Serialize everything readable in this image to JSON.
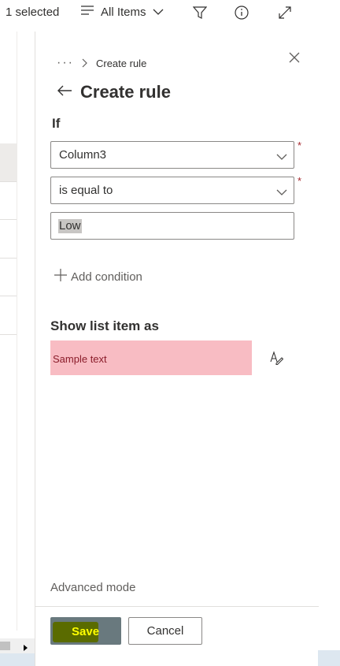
{
  "topbar": {
    "selected_text": "1 selected",
    "view_label": "All Items"
  },
  "panel": {
    "breadcrumb_current": "Create rule",
    "title": "Create rule",
    "if_label": "If",
    "condition": {
      "column_value": "Column3",
      "operator_value": "is equal to",
      "value": "Low",
      "required_marker": "*"
    },
    "add_condition_label": "Add condition",
    "show_label": "Show list item as",
    "sample_text": "Sample text",
    "sample_colors": {
      "background": "#f8bcc3",
      "text": "#8a1c2a"
    },
    "advanced_mode_label": "Advanced mode"
  },
  "footer": {
    "save_label": "Save",
    "cancel_label": "Cancel"
  },
  "colors": {
    "save_button": "#69797e",
    "save_highlight": "#5a6b00",
    "save_text": "#ffff00",
    "required": "#a4262c"
  },
  "icons": {
    "view": "list-lines-icon",
    "filter": "filter-icon",
    "info": "info-icon",
    "expand": "expand-icon",
    "close": "close-icon",
    "back": "back-arrow-icon",
    "edit_format": "edit-format-icon"
  }
}
